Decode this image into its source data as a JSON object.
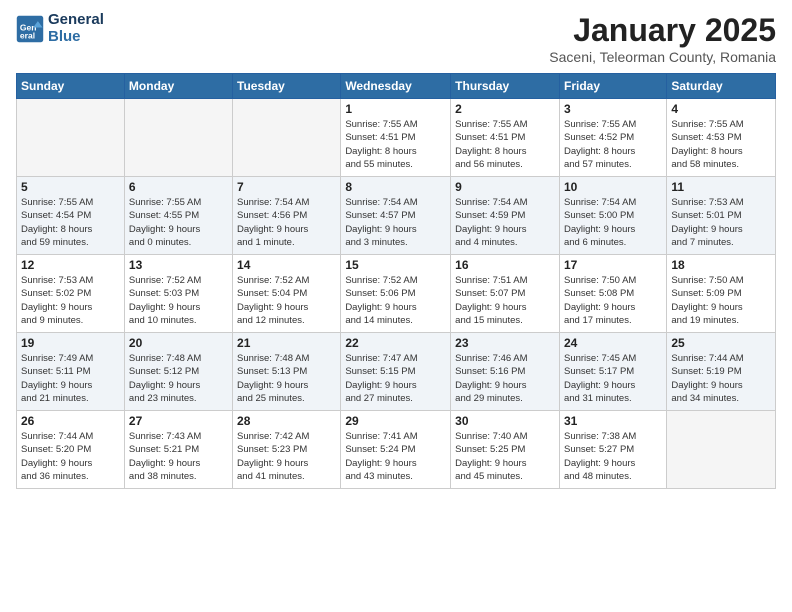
{
  "header": {
    "logo_line1": "General",
    "logo_line2": "Blue",
    "month": "January 2025",
    "location": "Saceni, Teleorman County, Romania"
  },
  "days_of_week": [
    "Sunday",
    "Monday",
    "Tuesday",
    "Wednesday",
    "Thursday",
    "Friday",
    "Saturday"
  ],
  "weeks": [
    [
      {
        "day": "",
        "info": ""
      },
      {
        "day": "",
        "info": ""
      },
      {
        "day": "",
        "info": ""
      },
      {
        "day": "1",
        "info": "Sunrise: 7:55 AM\nSunset: 4:51 PM\nDaylight: 8 hours\nand 55 minutes."
      },
      {
        "day": "2",
        "info": "Sunrise: 7:55 AM\nSunset: 4:51 PM\nDaylight: 8 hours\nand 56 minutes."
      },
      {
        "day": "3",
        "info": "Sunrise: 7:55 AM\nSunset: 4:52 PM\nDaylight: 8 hours\nand 57 minutes."
      },
      {
        "day": "4",
        "info": "Sunrise: 7:55 AM\nSunset: 4:53 PM\nDaylight: 8 hours\nand 58 minutes."
      }
    ],
    [
      {
        "day": "5",
        "info": "Sunrise: 7:55 AM\nSunset: 4:54 PM\nDaylight: 8 hours\nand 59 minutes."
      },
      {
        "day": "6",
        "info": "Sunrise: 7:55 AM\nSunset: 4:55 PM\nDaylight: 9 hours\nand 0 minutes."
      },
      {
        "day": "7",
        "info": "Sunrise: 7:54 AM\nSunset: 4:56 PM\nDaylight: 9 hours\nand 1 minute."
      },
      {
        "day": "8",
        "info": "Sunrise: 7:54 AM\nSunset: 4:57 PM\nDaylight: 9 hours\nand 3 minutes."
      },
      {
        "day": "9",
        "info": "Sunrise: 7:54 AM\nSunset: 4:59 PM\nDaylight: 9 hours\nand 4 minutes."
      },
      {
        "day": "10",
        "info": "Sunrise: 7:54 AM\nSunset: 5:00 PM\nDaylight: 9 hours\nand 6 minutes."
      },
      {
        "day": "11",
        "info": "Sunrise: 7:53 AM\nSunset: 5:01 PM\nDaylight: 9 hours\nand 7 minutes."
      }
    ],
    [
      {
        "day": "12",
        "info": "Sunrise: 7:53 AM\nSunset: 5:02 PM\nDaylight: 9 hours\nand 9 minutes."
      },
      {
        "day": "13",
        "info": "Sunrise: 7:52 AM\nSunset: 5:03 PM\nDaylight: 9 hours\nand 10 minutes."
      },
      {
        "day": "14",
        "info": "Sunrise: 7:52 AM\nSunset: 5:04 PM\nDaylight: 9 hours\nand 12 minutes."
      },
      {
        "day": "15",
        "info": "Sunrise: 7:52 AM\nSunset: 5:06 PM\nDaylight: 9 hours\nand 14 minutes."
      },
      {
        "day": "16",
        "info": "Sunrise: 7:51 AM\nSunset: 5:07 PM\nDaylight: 9 hours\nand 15 minutes."
      },
      {
        "day": "17",
        "info": "Sunrise: 7:50 AM\nSunset: 5:08 PM\nDaylight: 9 hours\nand 17 minutes."
      },
      {
        "day": "18",
        "info": "Sunrise: 7:50 AM\nSunset: 5:09 PM\nDaylight: 9 hours\nand 19 minutes."
      }
    ],
    [
      {
        "day": "19",
        "info": "Sunrise: 7:49 AM\nSunset: 5:11 PM\nDaylight: 9 hours\nand 21 minutes."
      },
      {
        "day": "20",
        "info": "Sunrise: 7:48 AM\nSunset: 5:12 PM\nDaylight: 9 hours\nand 23 minutes."
      },
      {
        "day": "21",
        "info": "Sunrise: 7:48 AM\nSunset: 5:13 PM\nDaylight: 9 hours\nand 25 minutes."
      },
      {
        "day": "22",
        "info": "Sunrise: 7:47 AM\nSunset: 5:15 PM\nDaylight: 9 hours\nand 27 minutes."
      },
      {
        "day": "23",
        "info": "Sunrise: 7:46 AM\nSunset: 5:16 PM\nDaylight: 9 hours\nand 29 minutes."
      },
      {
        "day": "24",
        "info": "Sunrise: 7:45 AM\nSunset: 5:17 PM\nDaylight: 9 hours\nand 31 minutes."
      },
      {
        "day": "25",
        "info": "Sunrise: 7:44 AM\nSunset: 5:19 PM\nDaylight: 9 hours\nand 34 minutes."
      }
    ],
    [
      {
        "day": "26",
        "info": "Sunrise: 7:44 AM\nSunset: 5:20 PM\nDaylight: 9 hours\nand 36 minutes."
      },
      {
        "day": "27",
        "info": "Sunrise: 7:43 AM\nSunset: 5:21 PM\nDaylight: 9 hours\nand 38 minutes."
      },
      {
        "day": "28",
        "info": "Sunrise: 7:42 AM\nSunset: 5:23 PM\nDaylight: 9 hours\nand 41 minutes."
      },
      {
        "day": "29",
        "info": "Sunrise: 7:41 AM\nSunset: 5:24 PM\nDaylight: 9 hours\nand 43 minutes."
      },
      {
        "day": "30",
        "info": "Sunrise: 7:40 AM\nSunset: 5:25 PM\nDaylight: 9 hours\nand 45 minutes."
      },
      {
        "day": "31",
        "info": "Sunrise: 7:38 AM\nSunset: 5:27 PM\nDaylight: 9 hours\nand 48 minutes."
      },
      {
        "day": "",
        "info": ""
      }
    ]
  ],
  "colors": {
    "header_bg": "#2e6da4",
    "row_even_bg": "#e8f0f7",
    "row_odd_bg": "#ffffff",
    "empty_bg": "#f5f5f5"
  }
}
